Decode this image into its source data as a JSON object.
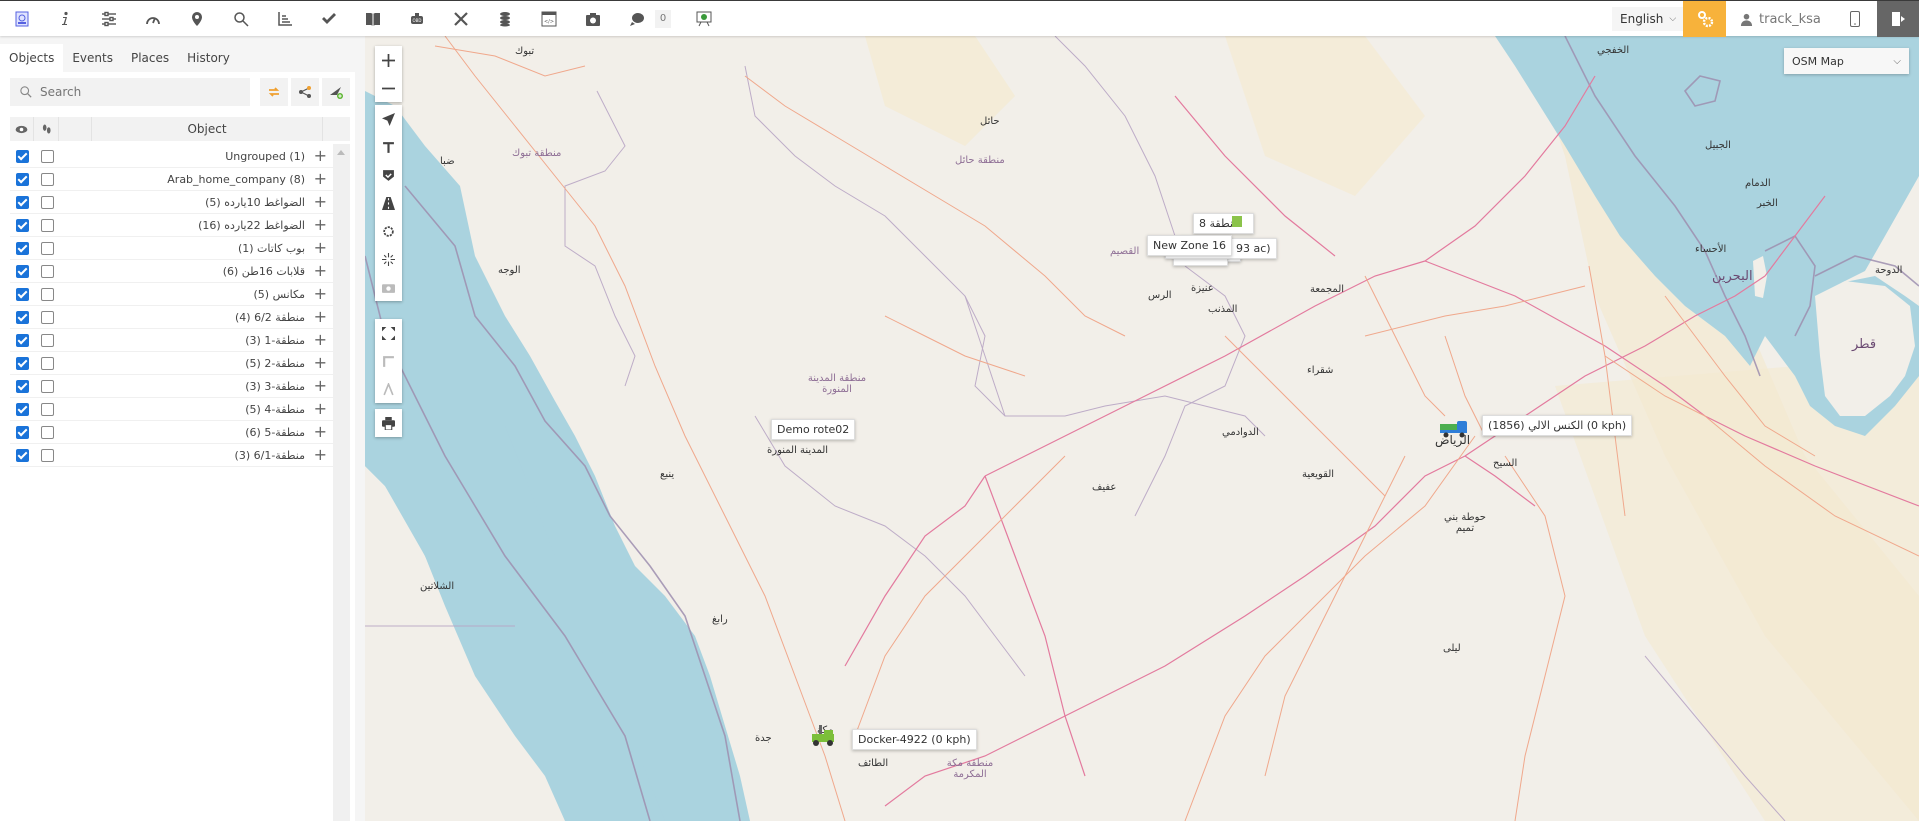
{
  "toolbar": {
    "icons": [
      "logo-icon",
      "info-icon",
      "settings-sliders-icon",
      "dashboard-gauge-icon",
      "marker-icon",
      "search-icon",
      "chart-icon",
      "check-icon",
      "book-icon",
      "obd-icon",
      "tools-icon",
      "coins-icon",
      "code-window-icon",
      "camera-icon",
      "chat-icon",
      "presentation-icon"
    ],
    "chat_count": "0",
    "language": "English",
    "username": "track_ksa"
  },
  "sidebar": {
    "tabs": [
      {
        "label": "Objects",
        "active": true
      },
      {
        "label": "Events",
        "active": false
      },
      {
        "label": "Places",
        "active": false
      },
      {
        "label": "History",
        "active": false
      }
    ],
    "search_placeholder": "Search",
    "table_header": {
      "object": "Object"
    },
    "groups": [
      {
        "label": "Ungrouped (1)",
        "visible": true,
        "follow": false
      },
      {
        "label": "Arab_home_company (8)",
        "visible": true,
        "follow": false
      },
      {
        "label": "(5) الضواغط 10يارده",
        "visible": true,
        "follow": false
      },
      {
        "label": "(16) الضواغط 22يارده",
        "visible": true,
        "follow": false
      },
      {
        "label": "(1) بوب كاتات",
        "visible": true,
        "follow": false
      },
      {
        "label": "(6) قلابات 16طن",
        "visible": true,
        "follow": false
      },
      {
        "label": "(5) مكانس",
        "visible": true,
        "follow": false
      },
      {
        "label": "(4) منطقة 6/2",
        "visible": true,
        "follow": false
      },
      {
        "label": "(3) منطقة-1",
        "visible": true,
        "follow": false
      },
      {
        "label": "(5) منطقة-2",
        "visible": true,
        "follow": false
      },
      {
        "label": "(3) منطقة-3",
        "visible": true,
        "follow": false
      },
      {
        "label": "(5) منطقة-4",
        "visible": true,
        "follow": false
      },
      {
        "label": "(6) منطقة-5",
        "visible": true,
        "follow": false
      },
      {
        "label": "(3) منطقة-6/1",
        "visible": true,
        "follow": false
      }
    ]
  },
  "map": {
    "layer": "OSM Map",
    "controls": [
      "zoom-in",
      "zoom-out",
      "navigate",
      "text",
      "shield",
      "road",
      "gear",
      "sun",
      "camera",
      "fullscreen",
      "ruler",
      "measure-angle",
      "print"
    ],
    "object_labels": [
      {
        "name": "new-zone-16-label",
        "text": "New Zone 16"
      },
      {
        "name": "zone-area-label",
        "text": "93 ac)"
      },
      {
        "name": "zone-8-label",
        "text": "منطقة 8"
      },
      {
        "name": "demo-route-label",
        "text": "Demo rote02"
      },
      {
        "name": "riyadh-vehicle-label",
        "text": "(1856) الكنس الالي (0 kph)"
      },
      {
        "name": "docker-vehicle-label",
        "text": "Docker-4922 (0 kph)"
      }
    ],
    "cities": [
      {
        "text": "تبوك"
      },
      {
        "text": "ضبا"
      },
      {
        "text": "الوجه"
      },
      {
        "text": "ينبع"
      },
      {
        "text": "رابغ"
      },
      {
        "text": "جدة"
      },
      {
        "text": "مكة"
      },
      {
        "text": "الطائف"
      },
      {
        "text": "المدينة المنورة"
      },
      {
        "text": "حائل"
      },
      {
        "text": "الرس"
      },
      {
        "text": "عنيزة"
      },
      {
        "text": "المذنب"
      },
      {
        "text": "المجمعة"
      },
      {
        "text": "شقراء"
      },
      {
        "text": "الدوادمي"
      },
      {
        "text": "عفيف"
      },
      {
        "text": "القويعية"
      },
      {
        "text": "الرياض"
      },
      {
        "text": "السيح"
      },
      {
        "text": "حوطة بني تميم"
      },
      {
        "text": "ليلى"
      },
      {
        "text": "الجبيل"
      },
      {
        "text": "الدمام"
      },
      {
        "text": "الخبر"
      },
      {
        "text": "الأحساء"
      },
      {
        "text": "الخفجي"
      },
      {
        "text": "الدوحة"
      },
      {
        "text": "الشلاتين"
      }
    ],
    "regions": [
      {
        "text": "منطقة تبوك"
      },
      {
        "text": "منطقة حائل"
      },
      {
        "text": "منطقة المدينة المنورة"
      },
      {
        "text": "منطقة مكة المكرمة"
      },
      {
        "text": "القصيم"
      }
    ],
    "countries": [
      {
        "text": "البحرين"
      },
      {
        "text": "قطر"
      }
    ]
  }
}
